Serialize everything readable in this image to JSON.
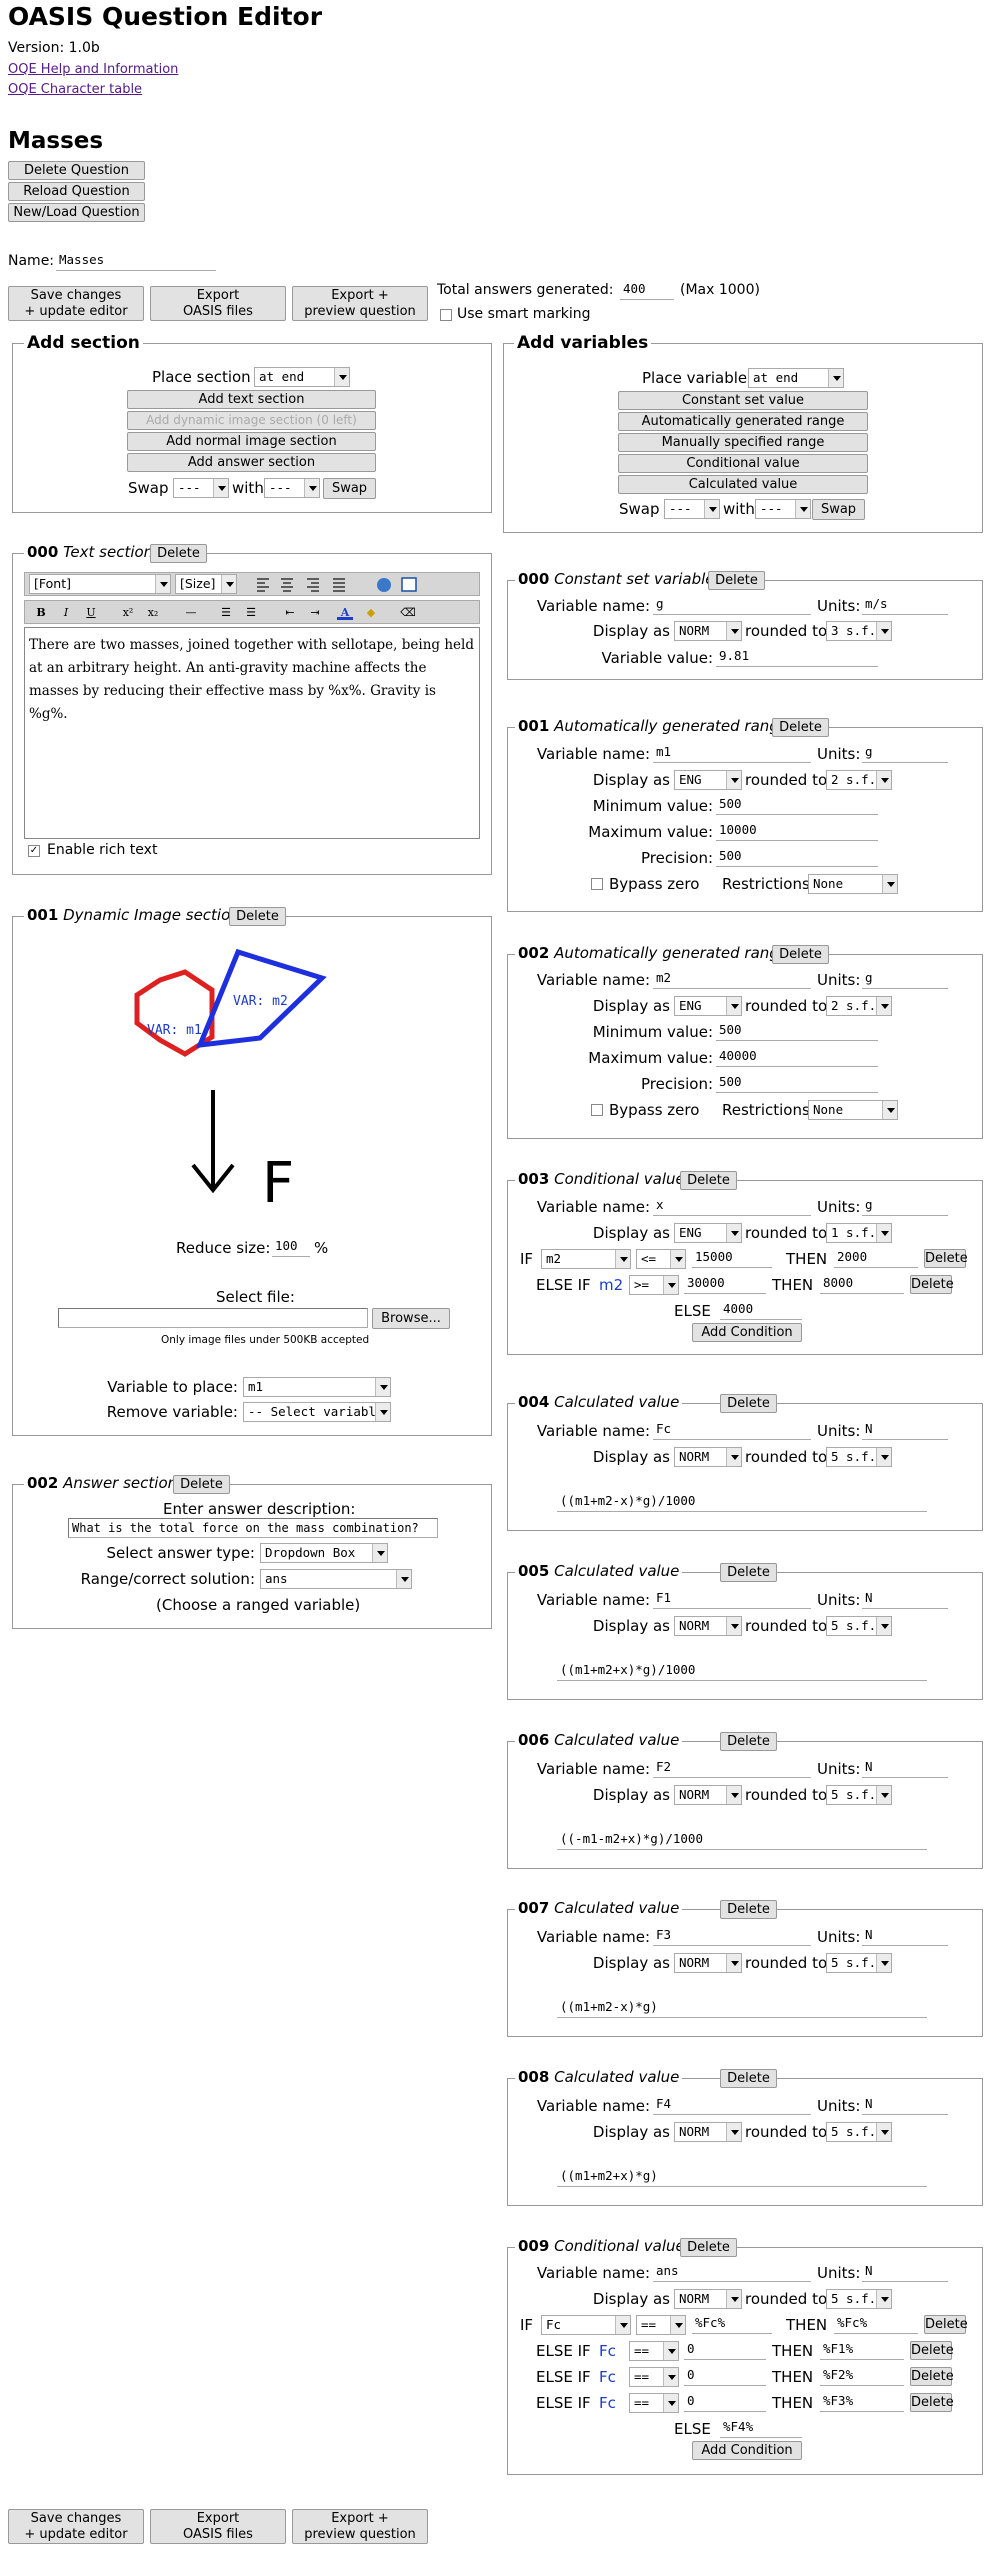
{
  "app": {
    "title": "OASIS Question Editor",
    "version": "Version: 1.0b",
    "help_link": "OQE Help and Information",
    "charset_link": "OQE Character table"
  },
  "question": {
    "heading": "Masses",
    "delete_btn": "Delete Question",
    "reload_btn": "Reload Question",
    "newload_btn": "New/Load Question",
    "name_label": "Name:",
    "name_value": "Masses"
  },
  "actions": {
    "save_l1": "Save changes",
    "save_l2": "+ update editor",
    "export_l1": "Export",
    "export_l2": "OASIS files",
    "preview_l1": "Export +",
    "preview_l2": "preview question",
    "total_label": "Total answers generated:",
    "total_value": "400",
    "total_max": "(Max 1000)",
    "smart": "Use smart marking"
  },
  "add_section": {
    "legend": "Add section",
    "place_label": "Place section",
    "place_value": "at end",
    "btn_text": "Add text section",
    "btn_dynimg": "Add dynamic image section (0 left)",
    "btn_normimg": "Add normal image section",
    "btn_answer": "Add answer section",
    "swap_label": "Swap",
    "with_label": "with",
    "swap_a": "---",
    "swap_b": "---",
    "swap_btn": "Swap"
  },
  "add_vars": {
    "legend": "Add variables",
    "place_label": "Place variable",
    "place_value": "at end",
    "btn_const": "Constant set value",
    "btn_auto": "Automatically generated range",
    "btn_manual": "Manually specified range",
    "btn_cond": "Conditional value",
    "btn_calc": "Calculated value",
    "swap_label": "Swap",
    "with_label": "with",
    "swap_a": "---",
    "swap_b": "---",
    "swap_btn": "Swap"
  },
  "labels": {
    "delete": "Delete",
    "varname": "Variable name:",
    "units": "Units:",
    "display_as": "Display as",
    "rounded_to": "rounded to",
    "var_value": "Variable value:",
    "min": "Minimum value:",
    "max": "Maximum value:",
    "precision": "Precision:",
    "bypass": "Bypass zero",
    "restrictions": "Restrictions:",
    "if": "IF",
    "then": "THEN",
    "else_if": "ELSE IF",
    "else": "ELSE",
    "add_cond": "Add Condition"
  },
  "s000": {
    "num": "000",
    "type": "Text section",
    "font": "[Font]",
    "size": "[Size]",
    "text": "There are two masses, joined together with sellotape, being held at an arbitrary height. An anti-gravity machine affects the masses by reducing their effective mass by %x%. Gravity is %g%.",
    "rich": "Enable rich text"
  },
  "s001": {
    "num": "001",
    "type": "Dynamic Image section",
    "var_m1": "VAR: m1",
    "var_m2": "VAR: m2",
    "force": "F",
    "reduce_label": "Reduce size:",
    "reduce_value": "100",
    "pct": "%",
    "select_file": "Select file:",
    "browse": "Browse...",
    "note": "Only image files under 500KB accepted",
    "var_place_label": "Variable to place:",
    "var_place_value": "m1",
    "remove_label": "Remove variable:",
    "remove_value": "-- Select variable --"
  },
  "s002": {
    "num": "002",
    "type": "Answer section",
    "desc_label": "Enter answer description:",
    "desc_value": "What is the total force on the mass combination?",
    "ans_type_label": "Select answer type:",
    "ans_type_value": "Dropdown Box",
    "range_label": "Range/correct solution:",
    "range_value": "ans",
    "hint": "(Choose a ranged variable)"
  },
  "v000": {
    "num": "000",
    "type": "Constant set variable",
    "name": "g",
    "units": "m/s",
    "display": "NORM",
    "rounded": "3 s.f.",
    "value": "9.81"
  },
  "v001": {
    "num": "001",
    "type": "Automatically generated range",
    "name": "m1",
    "units": "g",
    "display": "ENG",
    "rounded": "2 s.f.",
    "min": "500",
    "max": "10000",
    "precision": "500",
    "restrictions": "None"
  },
  "v002": {
    "num": "002",
    "type": "Automatically generated range",
    "name": "m2",
    "units": "g",
    "display": "ENG",
    "rounded": "2 s.f.",
    "min": "500",
    "max": "40000",
    "precision": "500",
    "restrictions": "None"
  },
  "v003": {
    "num": "003",
    "type": "Conditional value",
    "name": "x",
    "units": "g",
    "display": "ENG",
    "rounded": "1 s.f.",
    "if_var": "m2",
    "if_op": "<=",
    "if_val": "15000",
    "if_then": "2000",
    "elif_var": "m2",
    "elif_op": ">=",
    "elif_val": "30000",
    "elif_then": "8000",
    "else_val": "4000"
  },
  "v004": {
    "num": "004",
    "type": "Calculated value",
    "name": "Fc",
    "units": "N",
    "display": "NORM",
    "rounded": "5 s.f.",
    "formula": "((m1+m2-x)*g)/1000"
  },
  "v005": {
    "num": "005",
    "type": "Calculated value",
    "name": "F1",
    "units": "N",
    "display": "NORM",
    "rounded": "5 s.f.",
    "formula": "((m1+m2+x)*g)/1000"
  },
  "v006": {
    "num": "006",
    "type": "Calculated value",
    "name": "F2",
    "units": "N",
    "display": "NORM",
    "rounded": "5 s.f.",
    "formula": "((-m1-m2+x)*g)/1000"
  },
  "v007": {
    "num": "007",
    "type": "Calculated value",
    "name": "F3",
    "units": "N",
    "display": "NORM",
    "rounded": "5 s.f.",
    "formula": "((m1+m2-x)*g)"
  },
  "v008": {
    "num": "008",
    "type": "Calculated value",
    "name": "F4",
    "units": "N",
    "display": "NORM",
    "rounded": "5 s.f.",
    "formula": "((m1+m2+x)*g)"
  },
  "v009": {
    "num": "009",
    "type": "Conditional value",
    "name": "ans",
    "units": "N",
    "display": "NORM",
    "rounded": "5 s.f.",
    "if_var": "Fc",
    "if_op": "==",
    "if_val": "%Fc%",
    "if_then": "%Fc%",
    "c1_var": "Fc",
    "c1_op": "==",
    "c1_val": "0",
    "c1_then": "%F1%",
    "c2_var": "Fc",
    "c2_op": "==",
    "c2_val": "0",
    "c2_then": "%F2%",
    "c3_var": "Fc",
    "c3_op": "==",
    "c3_val": "0",
    "c3_then": "%F3%",
    "else_val": "%F4%"
  },
  "colors": {
    "blue_var": "#1e3cc8",
    "red_shape": "#dd2020",
    "blue_shape": "#1e2fdd"
  }
}
